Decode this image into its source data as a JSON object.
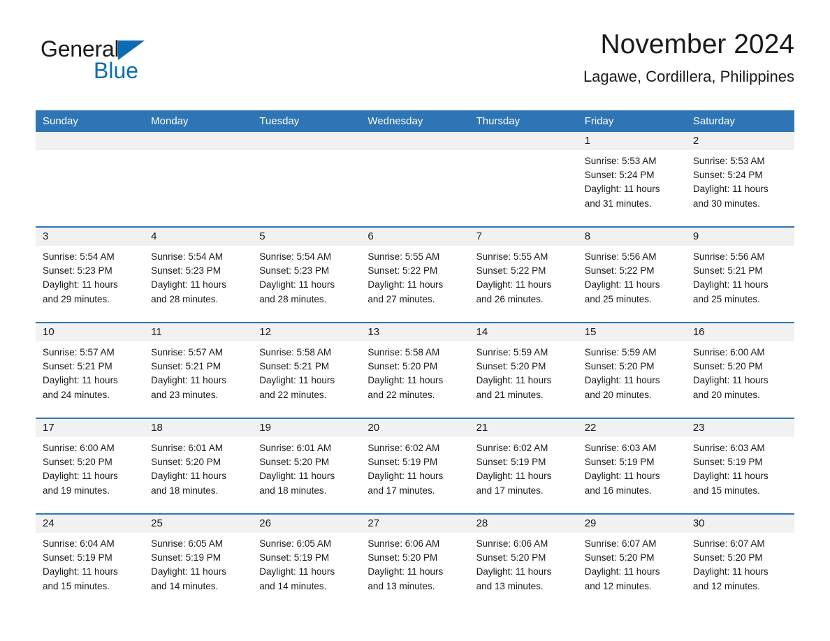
{
  "brand": {
    "name_part1": "General",
    "name_part2": "Blue",
    "triangle_color": "#0b6cb3"
  },
  "header": {
    "title": "November 2024",
    "subtitle": "Lagawe, Cordillera, Philippines"
  },
  "theme": {
    "accent": "#2e75b6",
    "date_strip": "#f1f1f1",
    "text": "#1a1a1a",
    "page_background": "#ffffff"
  },
  "calendar": {
    "weekday_headers": [
      "Sunday",
      "Monday",
      "Tuesday",
      "Wednesday",
      "Thursday",
      "Friday",
      "Saturday"
    ],
    "weeks": [
      [
        {
          "day": "",
          "lines": []
        },
        {
          "day": "",
          "lines": []
        },
        {
          "day": "",
          "lines": []
        },
        {
          "day": "",
          "lines": []
        },
        {
          "day": "",
          "lines": []
        },
        {
          "day": "1",
          "lines": [
            "Sunrise: 5:53 AM",
            "Sunset: 5:24 PM",
            "Daylight: 11 hours",
            "and 31 minutes."
          ]
        },
        {
          "day": "2",
          "lines": [
            "Sunrise: 5:53 AM",
            "Sunset: 5:24 PM",
            "Daylight: 11 hours",
            "and 30 minutes."
          ]
        }
      ],
      [
        {
          "day": "3",
          "lines": [
            "Sunrise: 5:54 AM",
            "Sunset: 5:23 PM",
            "Daylight: 11 hours",
            "and 29 minutes."
          ]
        },
        {
          "day": "4",
          "lines": [
            "Sunrise: 5:54 AM",
            "Sunset: 5:23 PM",
            "Daylight: 11 hours",
            "and 28 minutes."
          ]
        },
        {
          "day": "5",
          "lines": [
            "Sunrise: 5:54 AM",
            "Sunset: 5:23 PM",
            "Daylight: 11 hours",
            "and 28 minutes."
          ]
        },
        {
          "day": "6",
          "lines": [
            "Sunrise: 5:55 AM",
            "Sunset: 5:22 PM",
            "Daylight: 11 hours",
            "and 27 minutes."
          ]
        },
        {
          "day": "7",
          "lines": [
            "Sunrise: 5:55 AM",
            "Sunset: 5:22 PM",
            "Daylight: 11 hours",
            "and 26 minutes."
          ]
        },
        {
          "day": "8",
          "lines": [
            "Sunrise: 5:56 AM",
            "Sunset: 5:22 PM",
            "Daylight: 11 hours",
            "and 25 minutes."
          ]
        },
        {
          "day": "9",
          "lines": [
            "Sunrise: 5:56 AM",
            "Sunset: 5:21 PM",
            "Daylight: 11 hours",
            "and 25 minutes."
          ]
        }
      ],
      [
        {
          "day": "10",
          "lines": [
            "Sunrise: 5:57 AM",
            "Sunset: 5:21 PM",
            "Daylight: 11 hours",
            "and 24 minutes."
          ]
        },
        {
          "day": "11",
          "lines": [
            "Sunrise: 5:57 AM",
            "Sunset: 5:21 PM",
            "Daylight: 11 hours",
            "and 23 minutes."
          ]
        },
        {
          "day": "12",
          "lines": [
            "Sunrise: 5:58 AM",
            "Sunset: 5:21 PM",
            "Daylight: 11 hours",
            "and 22 minutes."
          ]
        },
        {
          "day": "13",
          "lines": [
            "Sunrise: 5:58 AM",
            "Sunset: 5:20 PM",
            "Daylight: 11 hours",
            "and 22 minutes."
          ]
        },
        {
          "day": "14",
          "lines": [
            "Sunrise: 5:59 AM",
            "Sunset: 5:20 PM",
            "Daylight: 11 hours",
            "and 21 minutes."
          ]
        },
        {
          "day": "15",
          "lines": [
            "Sunrise: 5:59 AM",
            "Sunset: 5:20 PM",
            "Daylight: 11 hours",
            "and 20 minutes."
          ]
        },
        {
          "day": "16",
          "lines": [
            "Sunrise: 6:00 AM",
            "Sunset: 5:20 PM",
            "Daylight: 11 hours",
            "and 20 minutes."
          ]
        }
      ],
      [
        {
          "day": "17",
          "lines": [
            "Sunrise: 6:00 AM",
            "Sunset: 5:20 PM",
            "Daylight: 11 hours",
            "and 19 minutes."
          ]
        },
        {
          "day": "18",
          "lines": [
            "Sunrise: 6:01 AM",
            "Sunset: 5:20 PM",
            "Daylight: 11 hours",
            "and 18 minutes."
          ]
        },
        {
          "day": "19",
          "lines": [
            "Sunrise: 6:01 AM",
            "Sunset: 5:20 PM",
            "Daylight: 11 hours",
            "and 18 minutes."
          ]
        },
        {
          "day": "20",
          "lines": [
            "Sunrise: 6:02 AM",
            "Sunset: 5:19 PM",
            "Daylight: 11 hours",
            "and 17 minutes."
          ]
        },
        {
          "day": "21",
          "lines": [
            "Sunrise: 6:02 AM",
            "Sunset: 5:19 PM",
            "Daylight: 11 hours",
            "and 17 minutes."
          ]
        },
        {
          "day": "22",
          "lines": [
            "Sunrise: 6:03 AM",
            "Sunset: 5:19 PM",
            "Daylight: 11 hours",
            "and 16 minutes."
          ]
        },
        {
          "day": "23",
          "lines": [
            "Sunrise: 6:03 AM",
            "Sunset: 5:19 PM",
            "Daylight: 11 hours",
            "and 15 minutes."
          ]
        }
      ],
      [
        {
          "day": "24",
          "lines": [
            "Sunrise: 6:04 AM",
            "Sunset: 5:19 PM",
            "Daylight: 11 hours",
            "and 15 minutes."
          ]
        },
        {
          "day": "25",
          "lines": [
            "Sunrise: 6:05 AM",
            "Sunset: 5:19 PM",
            "Daylight: 11 hours",
            "and 14 minutes."
          ]
        },
        {
          "day": "26",
          "lines": [
            "Sunrise: 6:05 AM",
            "Sunset: 5:19 PM",
            "Daylight: 11 hours",
            "and 14 minutes."
          ]
        },
        {
          "day": "27",
          "lines": [
            "Sunrise: 6:06 AM",
            "Sunset: 5:20 PM",
            "Daylight: 11 hours",
            "and 13 minutes."
          ]
        },
        {
          "day": "28",
          "lines": [
            "Sunrise: 6:06 AM",
            "Sunset: 5:20 PM",
            "Daylight: 11 hours",
            "and 13 minutes."
          ]
        },
        {
          "day": "29",
          "lines": [
            "Sunrise: 6:07 AM",
            "Sunset: 5:20 PM",
            "Daylight: 11 hours",
            "and 12 minutes."
          ]
        },
        {
          "day": "30",
          "lines": [
            "Sunrise: 6:07 AM",
            "Sunset: 5:20 PM",
            "Daylight: 11 hours",
            "and 12 minutes."
          ]
        }
      ]
    ]
  }
}
